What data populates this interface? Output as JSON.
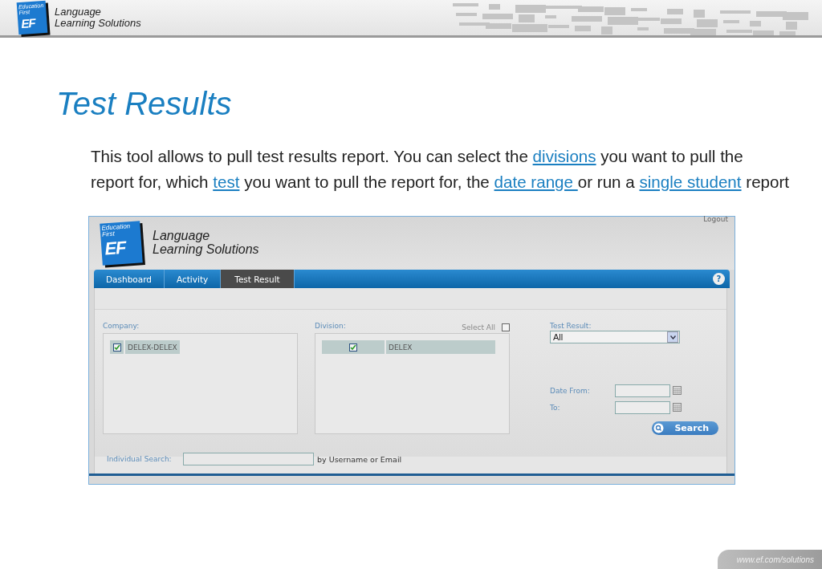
{
  "header": {
    "logo_small": "Education First",
    "logo_letters": "EF",
    "brand_line1": "Language",
    "brand_line2": "Learning Solutions"
  },
  "title": "Test Results",
  "intro": [
    {
      "text": "This tool allows to pull test results report. You can select the ",
      "link": false
    },
    {
      "text": "divisions",
      "link": true
    },
    {
      "text": " you want to pull the report for, which ",
      "link": false
    },
    {
      "text": "test",
      "link": true
    },
    {
      "text": " you want to pull the report for, the ",
      "link": false
    },
    {
      "text": "date range ",
      "link": true
    },
    {
      "text": " or run a ",
      "link": false
    },
    {
      "text": "single student",
      "link": true
    },
    {
      "text": " report",
      "link": false
    }
  ],
  "app": {
    "logo_small": "Education First",
    "logo_letters": "EF",
    "brand_line1": "Language",
    "brand_line2": "Learning Solutions",
    "logout": "Logout",
    "tabs": [
      {
        "label": "Dashboard",
        "selected": false
      },
      {
        "label": "Activity",
        "selected": false
      },
      {
        "label": "Test Result",
        "selected": true
      }
    ],
    "help": "?",
    "company": {
      "label": "Company:",
      "items": [
        {
          "label": "DELEX-DELEX",
          "checked": true
        }
      ]
    },
    "division": {
      "label": "Division:",
      "select_all": {
        "label": "Select All",
        "checked": false
      },
      "items": [
        {
          "label": "DELEX",
          "checked": true
        }
      ]
    },
    "test_result": {
      "label": "Test Result:",
      "value": "All"
    },
    "date_from": {
      "label": "Date  From:"
    },
    "date_to": {
      "label": "To:"
    },
    "search_button": "Search",
    "individual_search": {
      "label": "Individual Search:",
      "hint": "by Username or Email"
    }
  },
  "footer": "www.ef.com/solutions"
}
